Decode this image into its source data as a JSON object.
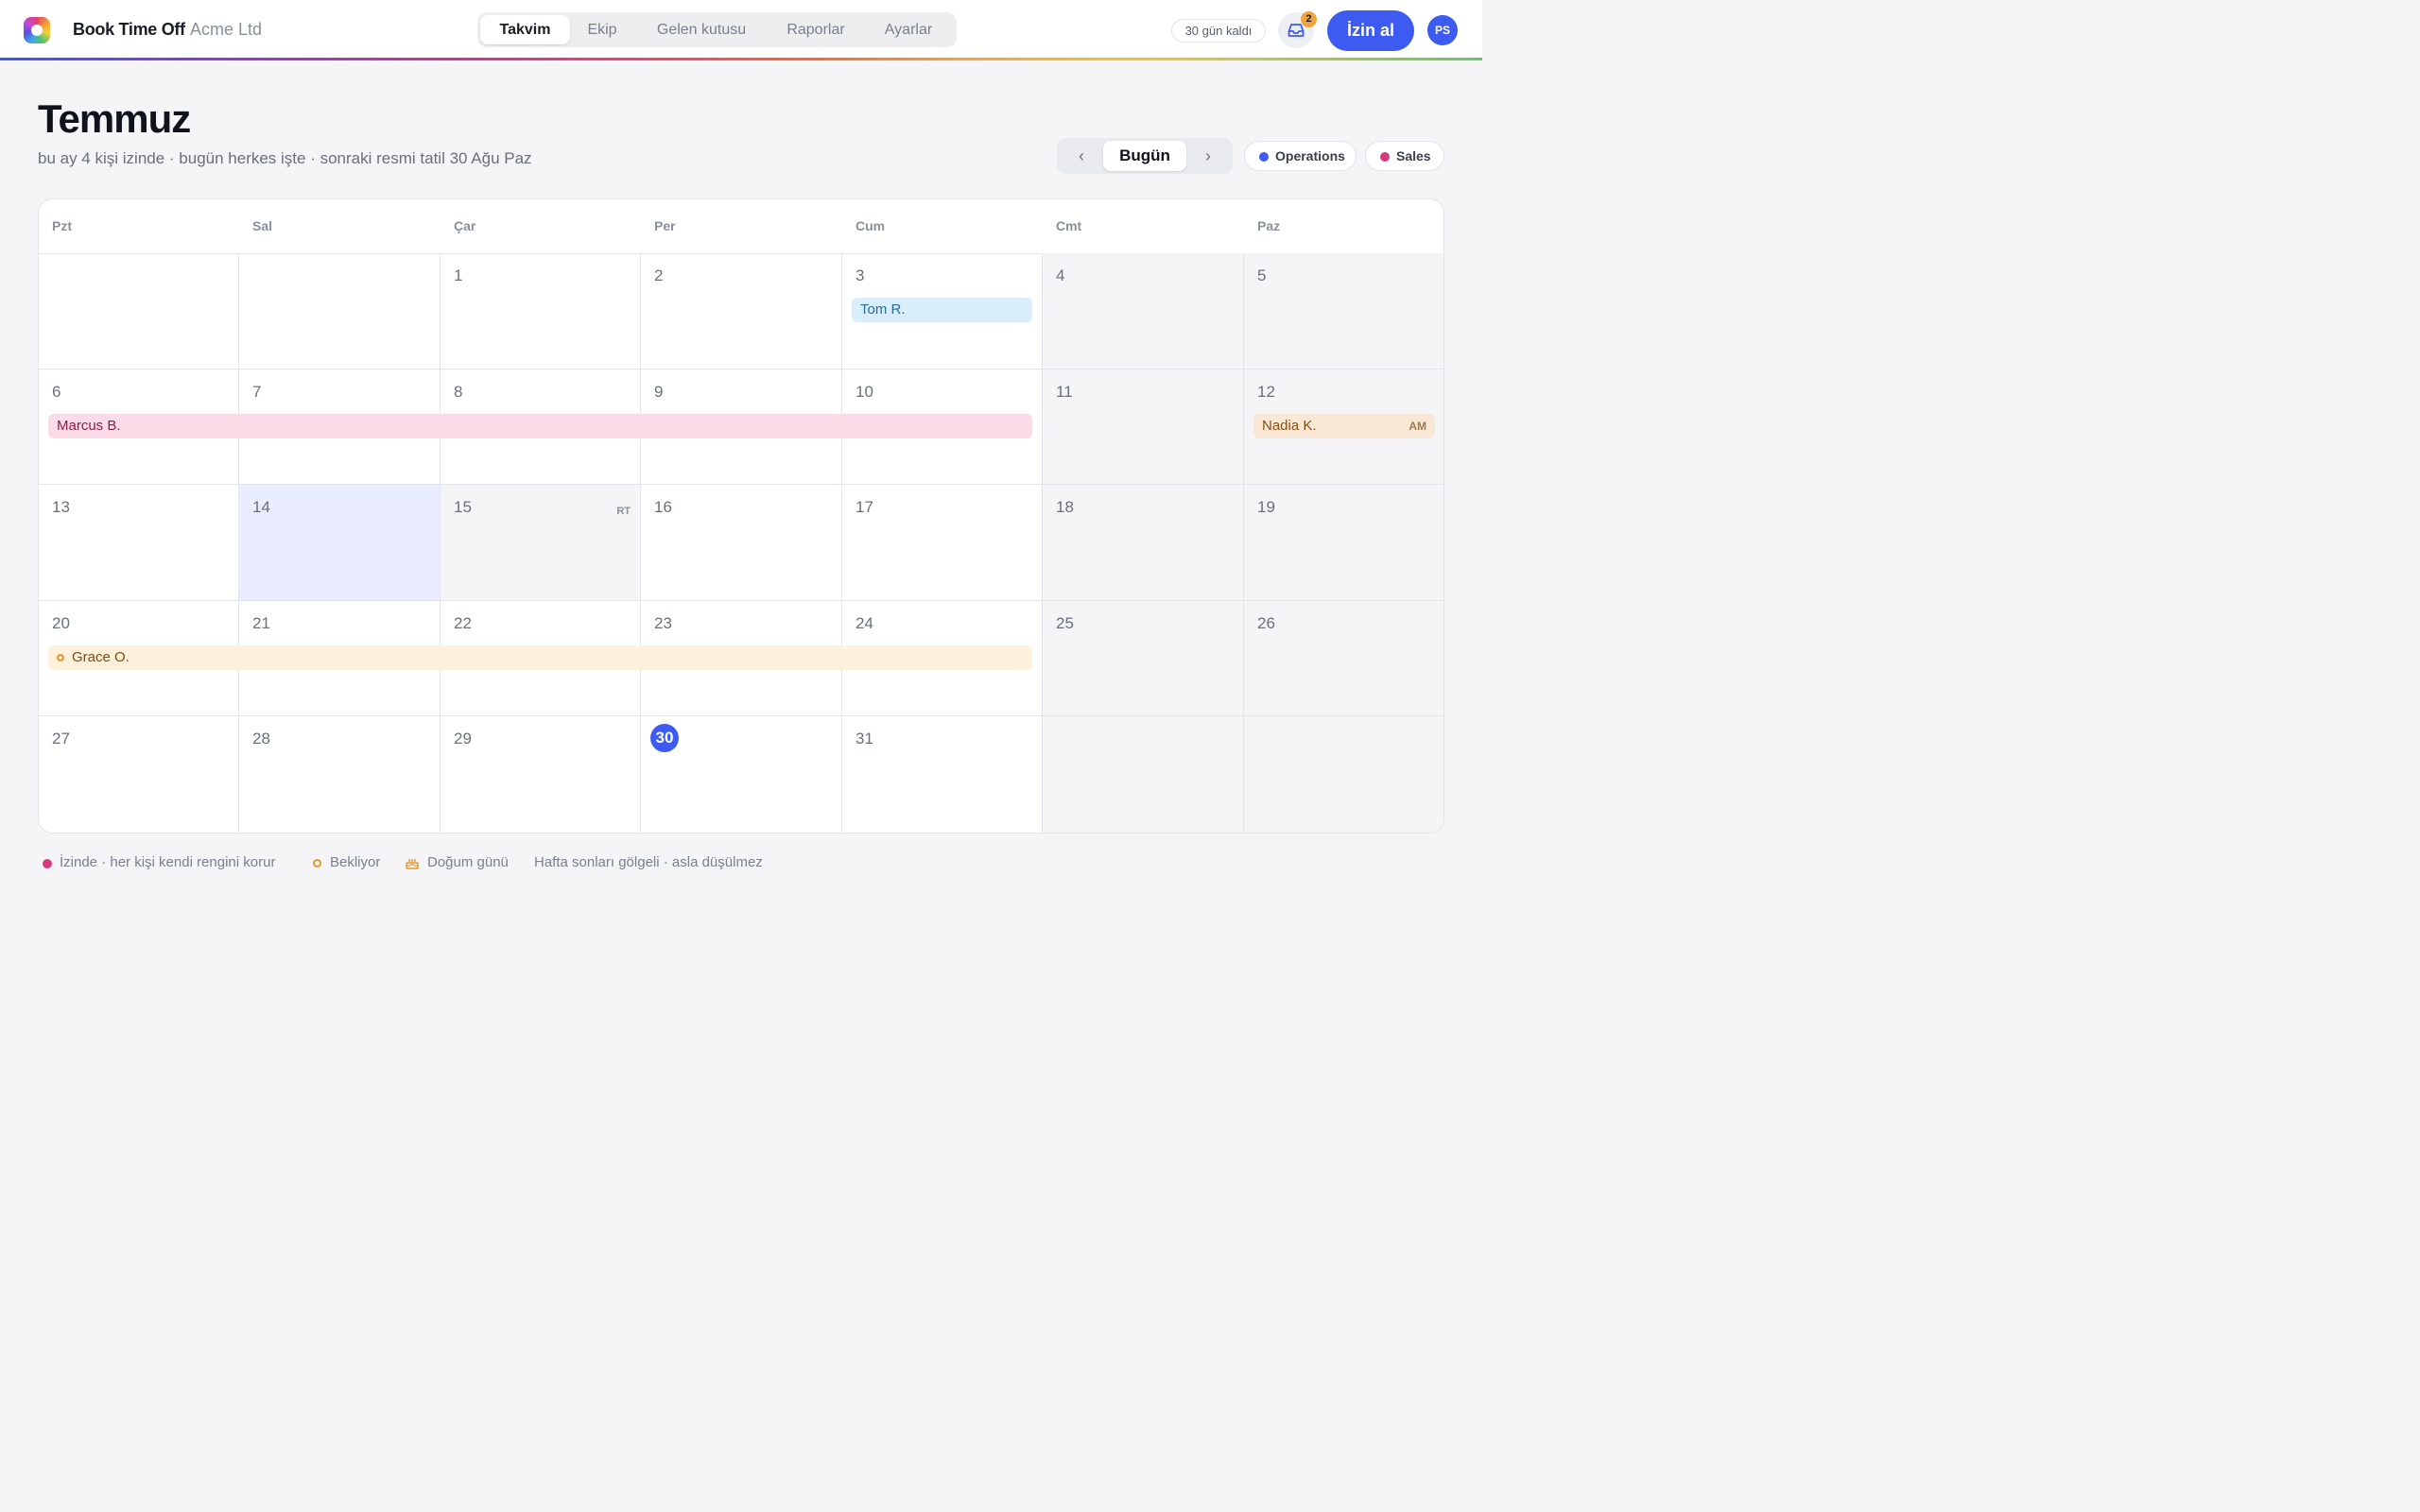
{
  "header": {
    "brand": "Book Time Off",
    "company": "Acme Ltd",
    "tabs": [
      {
        "label": "Takvim",
        "active": true
      },
      {
        "label": "Ekip"
      },
      {
        "label": "Gelen kutusu"
      },
      {
        "label": "Raporlar"
      },
      {
        "label": "Ayarlar"
      }
    ],
    "trial": "30 gün kaldı",
    "inbox_count": "2",
    "primary_button": "İzin al",
    "avatar_initials": "PS"
  },
  "page": {
    "title": "Temmuz",
    "subtitle": "bu ay 4 kişi izinde · bugün herkes işte · sonraki resmi tatil 30 Ağu Paz",
    "nav_prev": "‹",
    "today_button": "Bugün",
    "nav_next": "›",
    "filters": [
      {
        "label": "Operations",
        "color": "#3d5bf0"
      },
      {
        "label": "Sales",
        "color": "#d63a7a"
      }
    ]
  },
  "calendar": {
    "weekdays": [
      "Pzt",
      "Sal",
      "Çar",
      "Per",
      "Cum",
      "Cmt",
      "Paz"
    ],
    "weeks": [
      [
        "",
        "",
        "1",
        "2",
        "3",
        "4",
        "5"
      ],
      [
        "6",
        "7",
        "8",
        "9",
        "10",
        "11",
        "12"
      ],
      [
        "13",
        "14",
        "15",
        "16",
        "17",
        "18",
        "19"
      ],
      [
        "20",
        "21",
        "22",
        "23",
        "24",
        "25",
        "26"
      ],
      [
        "27",
        "28",
        "29",
        "30",
        "31",
        "",
        ""
      ]
    ],
    "today": "30",
    "selected_day": "14",
    "holiday": {
      "day": "15",
      "tag": "RT"
    },
    "events": {
      "tom": {
        "name": "Tom R."
      },
      "marcus": {
        "name": "Marcus B."
      },
      "nadia": {
        "name": "Nadia K.",
        "tag": "AM"
      },
      "grace": {
        "name": "Grace O.",
        "status": "pending"
      }
    }
  },
  "legend": {
    "on_leave": "İzinde · her kişi kendi rengini korur",
    "pending": "Bekliyor",
    "birthday": "Doğum günü",
    "weekends": "Hafta sonları gölgeli · asla düşülmez"
  }
}
